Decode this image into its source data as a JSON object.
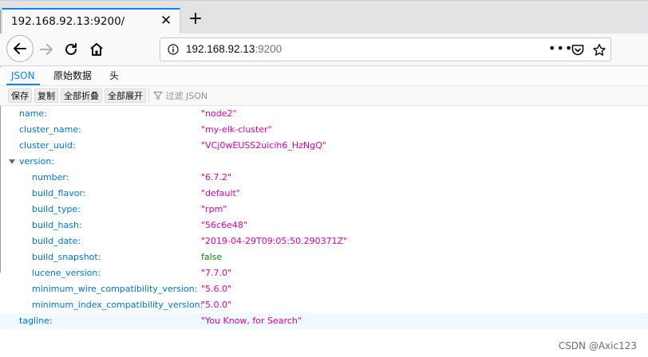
{
  "tab": {
    "title": "192.168.92.13:9200/",
    "close_icon": "close-icon",
    "new_tab_symbol": "+"
  },
  "urlbar": {
    "host": "192.168.92.13",
    "port": ":9200"
  },
  "viewer": {
    "tabs": [
      "JSON",
      "原始数据",
      "头"
    ],
    "active_tab": "JSON",
    "toolbar": {
      "save": "保存",
      "copy": "复制",
      "collapse_all": "全部折叠",
      "expand_all": "全部展开",
      "filter_placeholder": "过滤 JSON"
    }
  },
  "json": {
    "rows": [
      {
        "key": "name:",
        "value": "\"node2\"",
        "type": "string"
      },
      {
        "key": "cluster_name:",
        "value": "\"my-elk-cluster\"",
        "type": "string"
      },
      {
        "key": "cluster_uuid:",
        "value": "\"VCj0wEUSS2uicih6_HzNgQ\"",
        "type": "string"
      },
      {
        "key": "version:",
        "value": "",
        "type": "object",
        "expanded": true
      },
      {
        "key": "number:",
        "value": "\"6.7.2\"",
        "type": "string",
        "nested": true
      },
      {
        "key": "build_flavor:",
        "value": "\"default\"",
        "type": "string",
        "nested": true
      },
      {
        "key": "build_type:",
        "value": "\"rpm\"",
        "type": "string",
        "nested": true
      },
      {
        "key": "build_hash:",
        "value": "\"56c6e48\"",
        "type": "string",
        "nested": true
      },
      {
        "key": "build_date:",
        "value": "\"2019-04-29T09:05:50.290371Z\"",
        "type": "string",
        "nested": true
      },
      {
        "key": "build_snapshot:",
        "value": "false",
        "type": "boolean",
        "nested": true
      },
      {
        "key": "lucene_version:",
        "value": "\"7.7.0\"",
        "type": "string",
        "nested": true
      },
      {
        "key": "minimum_wire_compatibility_version:",
        "value": "\"5.6.0\"",
        "type": "string",
        "nested": true
      },
      {
        "key": "minimum_index_compatibility_version:",
        "value": "\"5.0.0\"",
        "type": "string",
        "nested": true
      },
      {
        "key": "tagline:",
        "value": "\"You Know, for Search\"",
        "type": "string",
        "highlighted": true
      }
    ]
  },
  "watermark": "CSDN @Axic123",
  "colors": {
    "accent": "#0a84ff",
    "key": "#0074e8",
    "string": "#dd00a9",
    "boolean": "#058b00"
  }
}
